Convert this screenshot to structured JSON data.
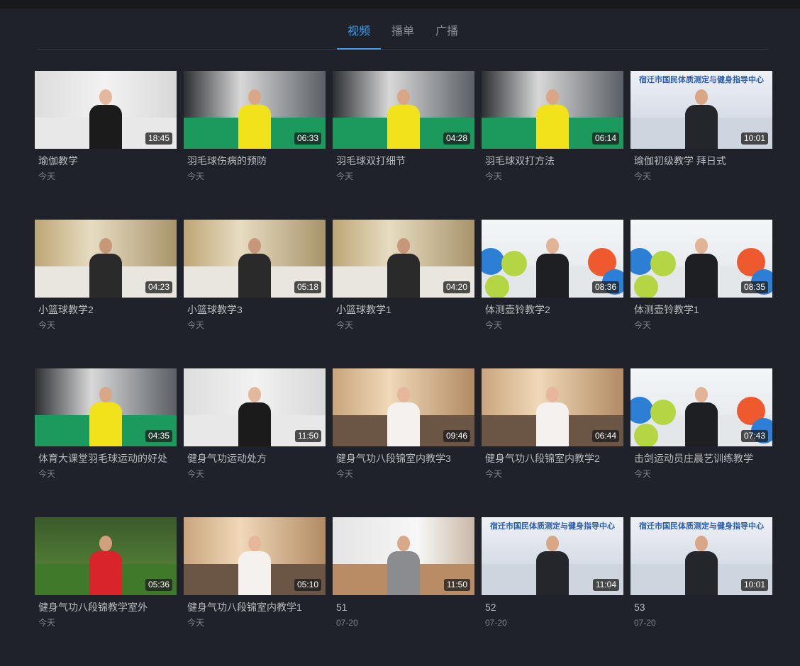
{
  "tabs": [
    {
      "label": "视频",
      "active": true
    },
    {
      "label": "播单",
      "active": false
    },
    {
      "label": "广播",
      "active": false
    }
  ],
  "videos": [
    {
      "title": "瑜伽教学",
      "date": "今天",
      "duration": "18:45",
      "scene": "studio"
    },
    {
      "title": "羽毛球伤病的预防",
      "date": "今天",
      "duration": "06:33",
      "scene": "court"
    },
    {
      "title": "羽毛球双打细节",
      "date": "今天",
      "duration": "04:28",
      "scene": "court"
    },
    {
      "title": "羽毛球双打方法",
      "date": "今天",
      "duration": "06:14",
      "scene": "court"
    },
    {
      "title": "瑜伽初级教学 拜日式",
      "date": "今天",
      "duration": "10:01",
      "scene": "banner",
      "banner": "宿迁市国民体质测定与健身指导中心"
    },
    {
      "title": "小篮球教学2",
      "date": "今天",
      "duration": "04:23",
      "scene": "gym"
    },
    {
      "title": "小篮球教学3",
      "date": "今天",
      "duration": "05:18",
      "scene": "gym"
    },
    {
      "title": "小篮球教学1",
      "date": "今天",
      "duration": "04:20",
      "scene": "gym"
    },
    {
      "title": "体测壶铃教学2",
      "date": "今天",
      "duration": "08:36",
      "scene": "balls"
    },
    {
      "title": "体测壶铃教学1",
      "date": "今天",
      "duration": "08:35",
      "scene": "balls"
    },
    {
      "title": "体育大课堂羽毛球运动的好处",
      "date": "今天",
      "duration": "04:35",
      "scene": "court"
    },
    {
      "title": "健身气功运动处方",
      "date": "今天",
      "duration": "11:50",
      "scene": "studio"
    },
    {
      "title": "健身气功八段锦室内教学3",
      "date": "今天",
      "duration": "09:46",
      "scene": "curtain"
    },
    {
      "title": "健身气功八段锦室内教学2",
      "date": "今天",
      "duration": "06:44",
      "scene": "curtain"
    },
    {
      "title": "击剑运动员庄晨艺训练教学",
      "date": "今天",
      "duration": "07:43",
      "scene": "balls"
    },
    {
      "title": "健身气功八段锦教学室外",
      "date": "今天",
      "duration": "05:36",
      "scene": "outdoor"
    },
    {
      "title": "健身气功八段锦室内教学1",
      "date": "今天",
      "duration": "05:10",
      "scene": "curtain"
    },
    {
      "title": "51",
      "date": "07-20",
      "duration": "11:50",
      "scene": "office"
    },
    {
      "title": "52",
      "date": "07-20",
      "duration": "11:04",
      "scene": "banner",
      "banner": "宿迁市国民体质测定与健身指导中心"
    },
    {
      "title": "53",
      "date": "07-20",
      "duration": "10:01",
      "scene": "banner",
      "banner": "宿迁市国民体质测定与健身指导中心"
    }
  ],
  "colors": {
    "accent": "#3aa1f2",
    "background": "#1f2228"
  }
}
